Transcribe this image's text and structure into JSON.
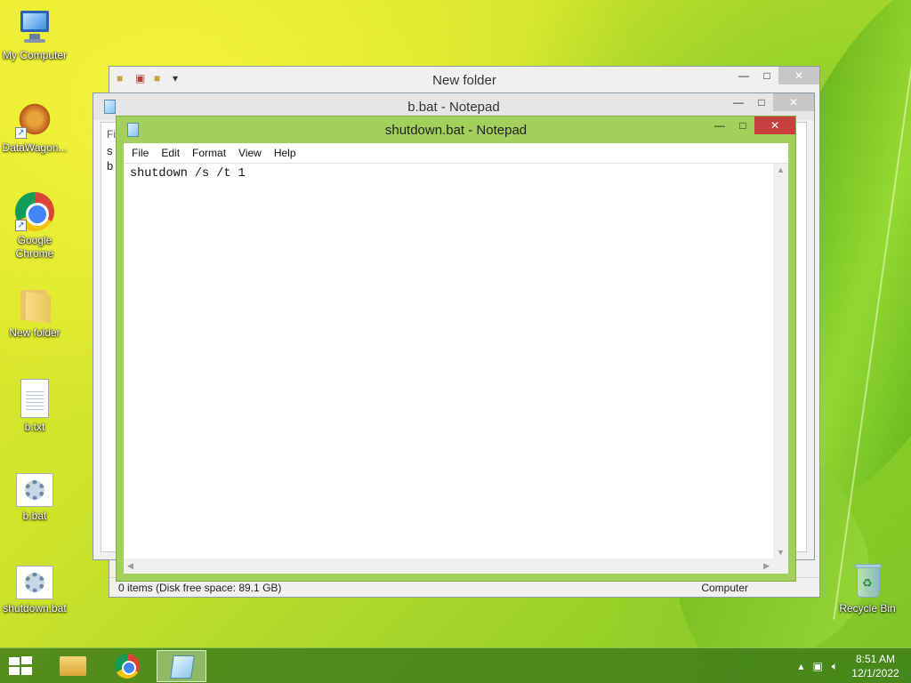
{
  "desktop": {
    "icons": [
      {
        "label": "My Computer"
      },
      {
        "label": "DataWagon..."
      },
      {
        "label": "Google Chrome"
      },
      {
        "label": "New folder"
      },
      {
        "label": "b.txt"
      },
      {
        "label": "b.bat"
      },
      {
        "label": "shutdown.bat"
      },
      {
        "label": "Recycle Bin"
      }
    ]
  },
  "explorer": {
    "title": "New folder",
    "status_left": "0 items (Disk free space: 89.1 GB)",
    "status_right": "Computer",
    "minimize": "—",
    "maximize": "□",
    "close": "✕"
  },
  "notepad_back": {
    "title": "b.bat - Notepad",
    "peek_line1": "s",
    "peek_line2": "b",
    "peek_menu": "Fi",
    "minimize": "—",
    "maximize": "□",
    "close": "✕"
  },
  "notepad_front": {
    "title": "shutdown.bat - Notepad",
    "menu": [
      "File",
      "Edit",
      "Format",
      "View",
      "Help"
    ],
    "content": "shutdown /s /t 1",
    "minimize": "—",
    "maximize": "□",
    "close": "✕"
  },
  "taskbar": {
    "time": "8:51 AM",
    "date": "12/1/2022"
  },
  "colors": {
    "active_title": "#a3cf5c",
    "close_active": "#c74040",
    "taskbar": "#3a7a18"
  }
}
